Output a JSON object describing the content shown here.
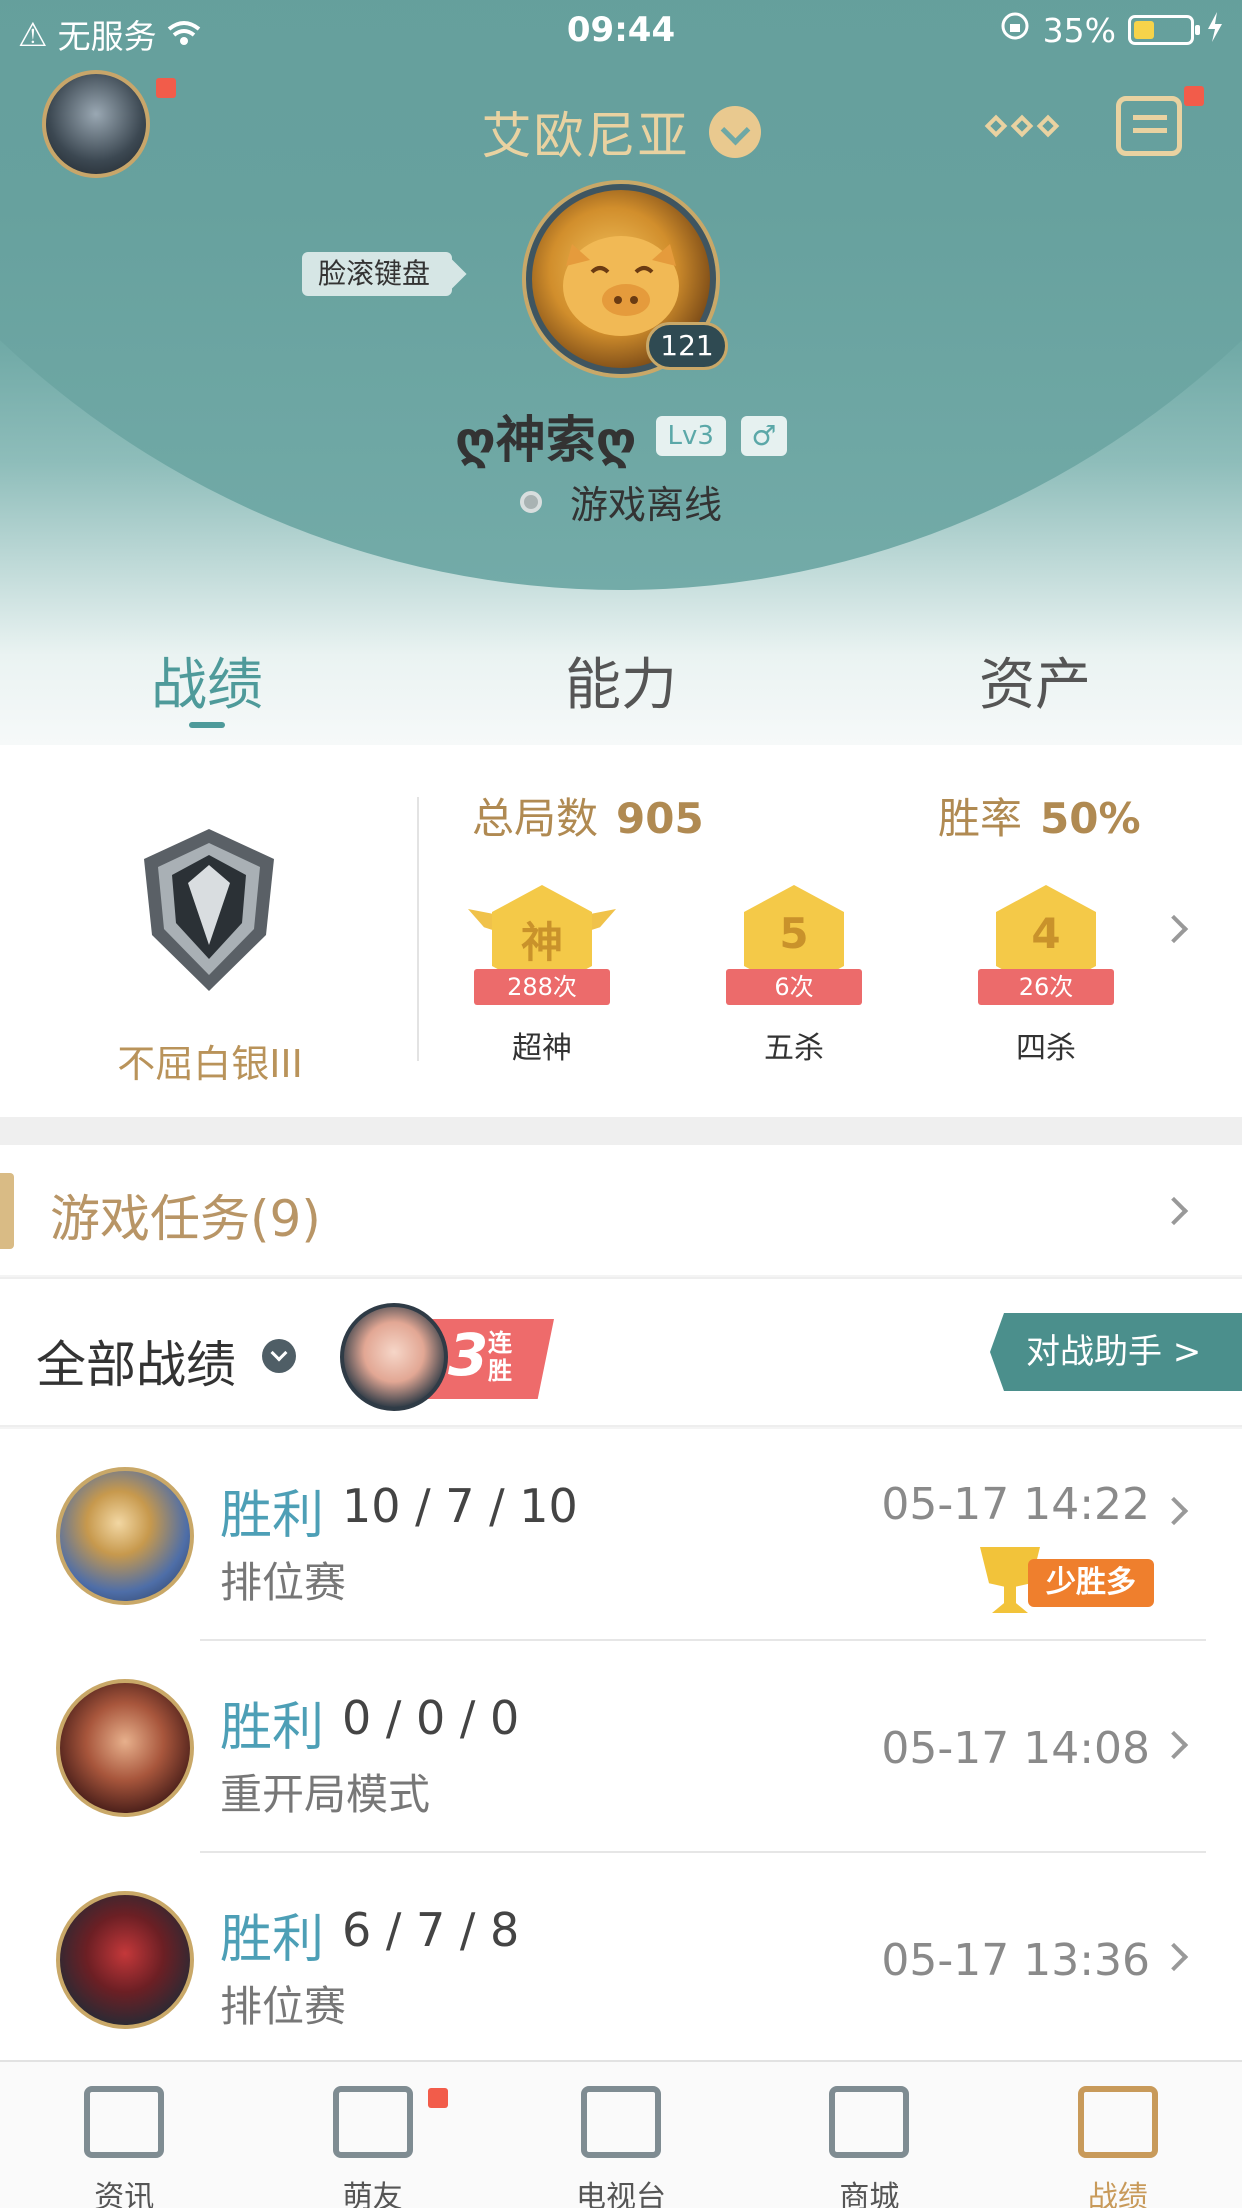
{
  "status_bar": {
    "carrier": "无服务",
    "time": "09:44",
    "battery": "35%"
  },
  "header": {
    "server_name": "艾欧尼亚",
    "tag": "脸滚键盘",
    "level_number": "121",
    "nickname": "ღ神索ღ",
    "lv_badge": "Lv3",
    "gender_symbol": "♂",
    "status_text": "游戏离线"
  },
  "tabs": [
    {
      "label": "战绩",
      "active": true
    },
    {
      "label": "能力",
      "active": false
    },
    {
      "label": "资产",
      "active": false
    }
  ],
  "stats": {
    "rank_name": "不屈白银III",
    "total_label": "总局数",
    "total_value": "905",
    "winrate_label": "胜率",
    "winrate_value": "50%",
    "medals": [
      {
        "glyph": "神",
        "count": "288次",
        "caption": "超神"
      },
      {
        "glyph": "5",
        "count": "6次",
        "caption": "五杀"
      },
      {
        "glyph": "4",
        "count": "26次",
        "caption": "四杀"
      }
    ]
  },
  "tasks": {
    "title": "游戏任务(9)"
  },
  "filter": {
    "label": "全部战绩",
    "streak_number": "3",
    "streak_text": "连胜",
    "assistant_label": "对战助手 >"
  },
  "matches": [
    {
      "result": "胜利",
      "kda": "10 / 7 / 10",
      "mode": "排位赛",
      "time": "05-17 14:22",
      "badge": "少胜多"
    },
    {
      "result": "胜利",
      "kda": "0 / 0 / 0",
      "mode": "重开局模式",
      "time": "05-17 14:08"
    },
    {
      "result": "胜利",
      "kda": "6 / 7 / 8",
      "mode": "排位赛",
      "time": "05-17 13:36"
    }
  ],
  "bottom_nav": [
    {
      "label": "资讯",
      "active": false
    },
    {
      "label": "萌友",
      "active": false
    },
    {
      "label": "电视台",
      "active": false
    },
    {
      "label": "商城",
      "active": false
    },
    {
      "label": "战绩",
      "active": true
    }
  ],
  "colors": {
    "teal": "#6ea8a5",
    "gold": "#b08a52",
    "win_blue": "#4d9fb6",
    "accent_red": "#ec6b6b"
  }
}
